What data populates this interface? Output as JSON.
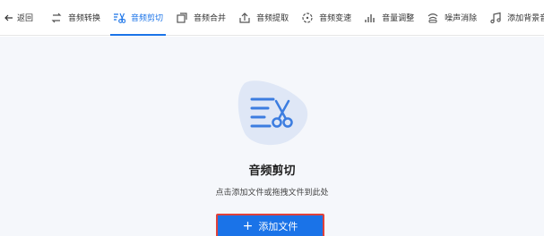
{
  "toolbar": {
    "back_label": "返回",
    "tools": [
      {
        "label": "音频转换",
        "icon": "swap-icon"
      },
      {
        "label": "音频剪切",
        "icon": "scissors-icon",
        "active": true
      },
      {
        "label": "音频合并",
        "icon": "merge-icon"
      },
      {
        "label": "音频提取",
        "icon": "extract-icon"
      },
      {
        "label": "音频变速",
        "icon": "speed-icon"
      },
      {
        "label": "音量调整",
        "icon": "volume-bars-icon"
      },
      {
        "label": "噪声消除",
        "icon": "noise-icon"
      },
      {
        "label": "添加背景音乐",
        "icon": "music-note-icon"
      }
    ]
  },
  "main": {
    "hero_icon": "audio-cut-icon",
    "title": "音频剪切",
    "hint": "点击添加文件或拖拽文件到此处",
    "add_button_label": "添加文件"
  },
  "colors": {
    "accent": "#1a73e8",
    "background": "#f5f7fb",
    "hero_blob": "#dfe7f6",
    "focus_outline": "#e0413b"
  }
}
